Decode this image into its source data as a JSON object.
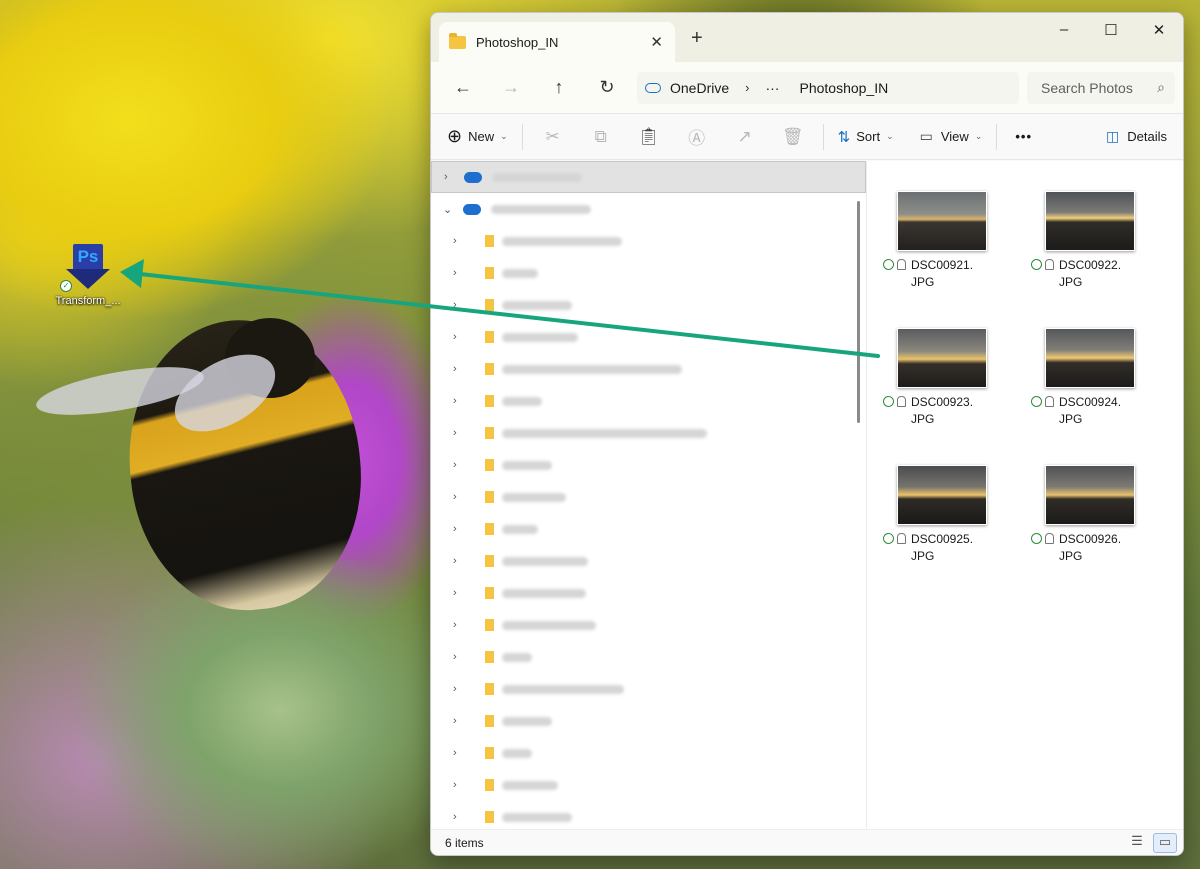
{
  "desktop": {
    "shortcut": {
      "label": "Transform_...",
      "icon": "photoshop-dropzone-icon"
    }
  },
  "window": {
    "tab_title": "Photoshop_IN",
    "controls": {
      "minimize": "–",
      "maximize": "☐",
      "close": "✕"
    }
  },
  "nav": {
    "back": "←",
    "forward": "→",
    "up": "↑",
    "refresh": "↻",
    "address": {
      "root": "OneDrive",
      "more": "···",
      "current": "Photoshop_IN"
    },
    "search_placeholder": "Search Photos"
  },
  "toolbar": {
    "new_label": "New",
    "sort_label": "Sort",
    "view_label": "View",
    "more_label": "•••",
    "details_label": "Details",
    "icons": [
      "cut-icon",
      "copy-icon",
      "paste-icon",
      "rename-icon",
      "share-icon",
      "delete-icon"
    ]
  },
  "files": [
    {
      "name": "DSC00921.JPG"
    },
    {
      "name": "DSC00922.JPG"
    },
    {
      "name": "DSC00923.JPG"
    },
    {
      "name": "DSC00924.JPG"
    },
    {
      "name": "DSC00925.JPG"
    },
    {
      "name": "DSC00926.JPG"
    }
  ],
  "status": {
    "item_count": "6 items"
  },
  "colors": {
    "accent": "#1a6fc4",
    "drag_arrow": "#16a57c",
    "folder": "#f5c542",
    "sync_ok": "#2e8b3a"
  }
}
